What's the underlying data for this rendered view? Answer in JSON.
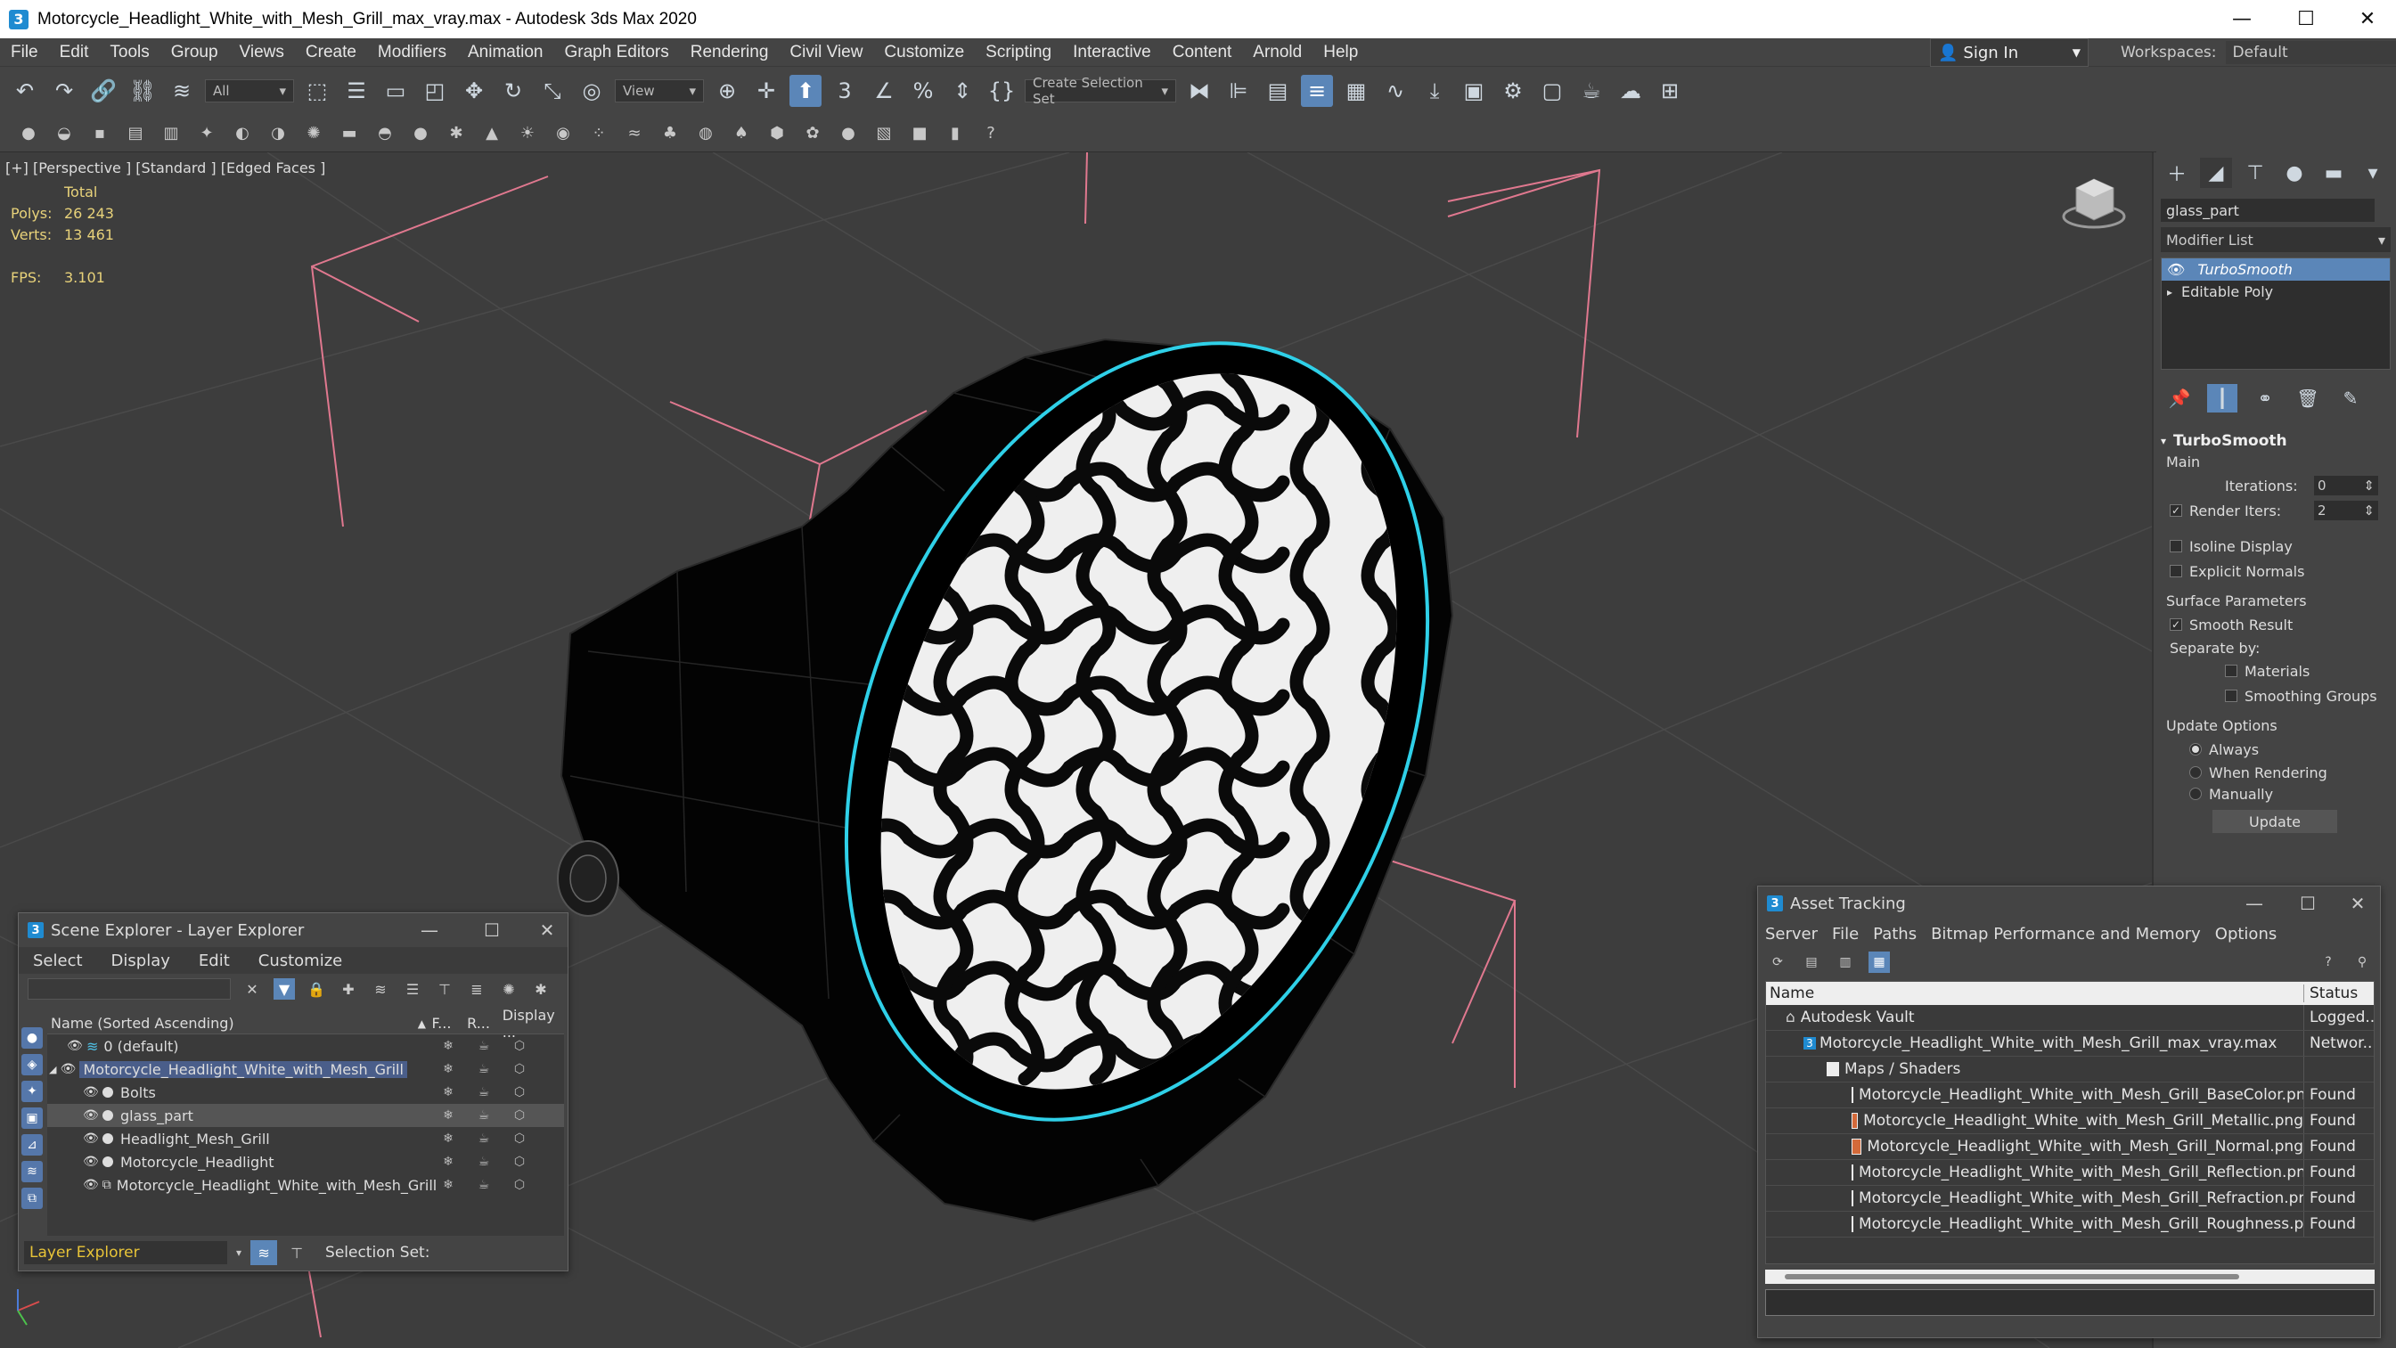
{
  "window": {
    "title": "Motorcycle_Headlight_White_with_Mesh_Grill_max_vray.max - Autodesk 3ds Max 2020",
    "app_icon": "3",
    "minimize": "—",
    "maximize": "☐",
    "close": "✕"
  },
  "menu": [
    "File",
    "Edit",
    "Tools",
    "Group",
    "Views",
    "Create",
    "Modifiers",
    "Animation",
    "Graph Editors",
    "Rendering",
    "Civil View",
    "Customize",
    "Scripting",
    "Interactive",
    "Content",
    "Arnold",
    "Help"
  ],
  "signin": {
    "label": "Sign In"
  },
  "workspace": {
    "label": "Workspaces:",
    "value": "Default"
  },
  "toolbar": {
    "filter_value": "All",
    "ref_coord_value": "View",
    "selection_set_placeholder": "Create Selection Set"
  },
  "viewport": {
    "label": "[+] [Perspective ] [Standard ] [Edged Faces ]",
    "stats_total_label": "Total",
    "polys_label": "Polys:",
    "polys_value": "26 243",
    "verts_label": "Verts:",
    "verts_value": "13 461",
    "fps_label": "FPS:",
    "fps_value": "3.101"
  },
  "command_panel": {
    "object_name": "glass_part",
    "modifier_list": "Modifier List",
    "stack": [
      {
        "label": "TurboSmooth",
        "selected": true
      },
      {
        "label": "Editable Poly",
        "selected": false
      }
    ],
    "rollout_title": "TurboSmooth",
    "main_label": "Main",
    "iterations_label": "Iterations:",
    "iterations_value": "0",
    "render_iters_label": "Render Iters:",
    "render_iters_value": "2",
    "isoline_label": "Isoline Display",
    "explicit_normals_label": "Explicit Normals",
    "surface_params_label": "Surface Parameters",
    "smooth_result_label": "Smooth Result",
    "separate_by_label": "Separate by:",
    "materials_label": "Materials",
    "smoothing_groups_label": "Smoothing Groups",
    "update_options_label": "Update Options",
    "always_label": "Always",
    "when_rendering_label": "When Rendering",
    "manually_label": "Manually",
    "update_button": "Update"
  },
  "scene_explorer": {
    "title": "Scene Explorer - Layer Explorer",
    "menu": [
      "Select",
      "Display",
      "Edit",
      "Customize"
    ],
    "col_name": "Name (Sorted Ascending)",
    "col_f": "F...",
    "col_r": "R...",
    "col_display": "Display ...",
    "rows": [
      {
        "name": "0 (default)",
        "indent": 1
      },
      {
        "name": "Motorcycle_Headlight_White_with_Mesh_Grill",
        "indent": 0
      },
      {
        "name": "Bolts",
        "indent": 2
      },
      {
        "name": "glass_part",
        "indent": 2
      },
      {
        "name": "Headlight_Mesh_Grill",
        "indent": 2
      },
      {
        "name": "Motorcycle_Headlight",
        "indent": 2
      },
      {
        "name": "Motorcycle_Headlight_White_with_Mesh_Grill",
        "indent": 2
      }
    ],
    "footer_layer": "Layer Explorer",
    "footer_selection_set": "Selection Set:"
  },
  "asset_tracking": {
    "title": "Asset Tracking",
    "menu": [
      "Server",
      "File",
      "Paths",
      "Bitmap Performance and Memory",
      "Options"
    ],
    "col_name": "Name",
    "col_status": "Status",
    "rows": [
      {
        "name": "Autodesk Vault",
        "status": "Logged..."
      },
      {
        "name": "Motorcycle_Headlight_White_with_Mesh_Grill_max_vray.max",
        "status": "Networ..."
      },
      {
        "name": "Maps / Shaders",
        "status": ""
      },
      {
        "name": "Motorcycle_Headlight_White_with_Mesh_Grill_BaseColor.png",
        "status": "Found"
      },
      {
        "name": "Motorcycle_Headlight_White_with_Mesh_Grill_Metallic.png",
        "status": "Found"
      },
      {
        "name": "Motorcycle_Headlight_White_with_Mesh_Grill_Normal.png",
        "status": "Found"
      },
      {
        "name": "Motorcycle_Headlight_White_with_Mesh_Grill_Reflection.png",
        "status": "Found"
      },
      {
        "name": "Motorcycle_Headlight_White_with_Mesh_Grill_Refraction.png",
        "status": "Found"
      },
      {
        "name": "Motorcycle_Headlight_White_with_Mesh_Grill_Roughness.png",
        "status": "Found"
      }
    ]
  },
  "colors": {
    "accent": "#5b86b8",
    "selection_outline": "#2fd0e8",
    "bbox_lines": "#e0788f",
    "stats_yellow": "#e8d27a",
    "layer_yellow": "#e8c438"
  }
}
